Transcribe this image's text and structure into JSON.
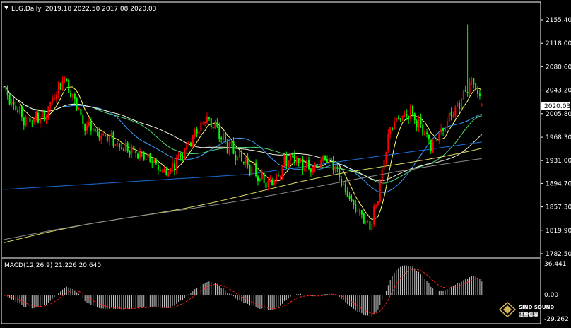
{
  "header": {
    "symbol_tf": "LLG,Daily",
    "ohlc": "2019.18 2022.50 2017.08 2020.03"
  },
  "price_axis": {
    "ticks": [
      "2155.40",
      "2118.00",
      "2080.60",
      "2043.20",
      "2005.80",
      "1968.30",
      "1931.00",
      "1894.70",
      "1857.30",
      "1819.90",
      "1782.50"
    ],
    "current": "2020.03"
  },
  "macd": {
    "label": "MACD(12,26,9) 21.226 20.640",
    "ticks": [
      "36.441",
      "0.00",
      "-29.262"
    ]
  },
  "logo": {
    "line1": "SINO SOUND",
    "line2": "漢聲集團"
  },
  "colors": {
    "bg": "#000000",
    "bull": "#00ff00",
    "bear": "#ff0000",
    "ma_fast": "#ffff66",
    "ma_blue1": "#3fa0ff",
    "ma_green": "#4fdc7a",
    "ma_white": "#f2f2dc",
    "ma_yellow2": "#dcdc64",
    "ma_grey": "#8c8c8c",
    "ma_blue2": "#1a6fd8",
    "signal": "#ff2020",
    "hist": "#c8c8c8"
  },
  "chart_data": {
    "type": "candlestick",
    "symbol": "LLG",
    "timeframe": "Daily",
    "last_bar": {
      "open": 2019.18,
      "high": 2022.5,
      "low": 2017.08,
      "close": 2020.03
    },
    "ylim": [
      1782.5,
      2165.0
    ],
    "anchors": [
      [
        0,
        2048
      ],
      [
        10,
        1995
      ],
      [
        20,
        2000
      ],
      [
        30,
        2065
      ],
      [
        40,
        1985
      ],
      [
        50,
        1970
      ],
      [
        60,
        1950
      ],
      [
        70,
        1935
      ],
      [
        80,
        1910
      ],
      [
        90,
        1955
      ],
      [
        100,
        2000
      ],
      [
        110,
        1955
      ],
      [
        120,
        1925
      ],
      [
        130,
        1890
      ],
      [
        140,
        1935
      ],
      [
        150,
        1920
      ],
      [
        160,
        1935
      ],
      [
        170,
        1870
      ],
      [
        180,
        1825
      ],
      [
        185,
        1890
      ],
      [
        190,
        1985
      ],
      [
        200,
        2010
      ],
      [
        210,
        1955
      ],
      [
        220,
        2000
      ],
      [
        230,
        2060
      ],
      [
        235,
        2025
      ]
    ],
    "macd_values": {
      "macd": 21.226,
      "signal": 20.64
    },
    "macd_ylim": [
      -29.262,
      36.441
    ]
  }
}
